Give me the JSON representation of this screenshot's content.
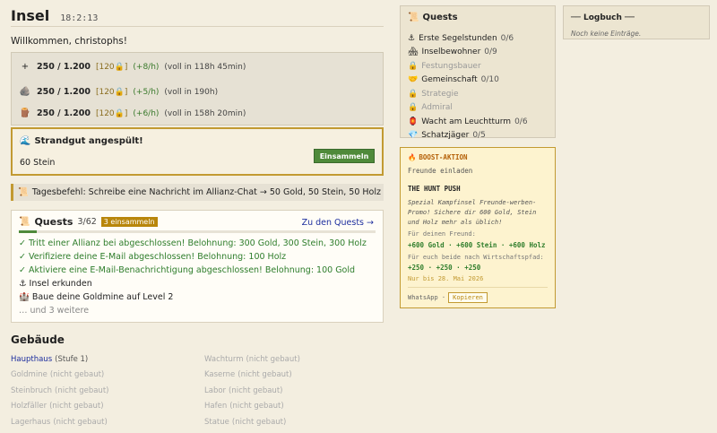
{
  "header": {
    "title": "Insel",
    "clock": "18:2:13"
  },
  "welcome": "Willkommen, christophs!",
  "resources": [
    {
      "icon": "gold-icon",
      "glyph": "+",
      "amount": "250 / 1.200",
      "cap": "[120🔒]",
      "rate": "(+8/h)",
      "full": "(voll in 118h 45min)"
    },
    {
      "icon": "stone-icon",
      "glyph": "🪨",
      "amount": "250 / 1.200",
      "cap": "[120🔒]",
      "rate": "(+5/h)",
      "full": "(voll in 190h)"
    },
    {
      "icon": "wood-icon",
      "glyph": "🪵",
      "amount": "250 / 1.200",
      "cap": "[120🔒]",
      "rate": "(+6/h)",
      "full": "(voll in 158h 20min)"
    }
  ],
  "alert": {
    "icon_glyph": "🌊",
    "title": "Strandgut angespült!",
    "text": "60 Stein",
    "button": "Einsammeln"
  },
  "daily": {
    "icon_glyph": "📜",
    "text": "Tagesbefehl: Schreibe eine Nachricht im Allianz-Chat → 50 Gold, 50 Stein, 50 Holz"
  },
  "quests": {
    "icon_glyph": "📜",
    "title": "Quests",
    "count": "3/62",
    "badge": "3 einsammeln",
    "link": "Zu den Quests →",
    "progress": 0.05,
    "items": [
      {
        "text": "✓ Tritt einer Allianz bei abgeschlossen! Belohnung: 300 Gold, 300 Stein, 300 Holz",
        "state": "done"
      },
      {
        "text": "✓ Verifiziere deine E-Mail abgeschlossen! Belohnung: 100 Holz",
        "state": "done"
      },
      {
        "text": "✓ Aktiviere eine E-Mail-Benachrichtigung abgeschlossen! Belohnung: 100 Gold",
        "state": "done"
      },
      {
        "text": "⚓ Insel erkunden",
        "state": "open"
      },
      {
        "text": "🏰 Baue deine Goldmine auf Level 2",
        "state": "open"
      },
      {
        "text": "… und 3 weitere",
        "state": "more"
      }
    ]
  },
  "buildings": {
    "title": "Gebäude",
    "col1": [
      {
        "name": "Haupthaus",
        "state": "(Stufe 1)",
        "active": true
      },
      {
        "name": "Goldmine",
        "state": "(nicht gebaut)",
        "active": false
      },
      {
        "name": "Steinbruch",
        "state": "(nicht gebaut)",
        "active": false
      },
      {
        "name": "Holzfäller",
        "state": "(nicht gebaut)",
        "active": false
      },
      {
        "name": "Lagerhaus",
        "state": "(nicht gebaut)",
        "active": false
      },
      {
        "name": "Steinmauer",
        "state": "(nicht gebaut)",
        "active": false
      }
    ],
    "col2": [
      {
        "name": "Wachturm",
        "state": "(nicht gebaut)",
        "active": false
      },
      {
        "name": "Kaserne",
        "state": "(nicht gebaut)",
        "active": false
      },
      {
        "name": "Labor",
        "state": "(nicht gebaut)",
        "active": false
      },
      {
        "name": "Hafen",
        "state": "(nicht gebaut)",
        "active": false
      },
      {
        "name": "Statue",
        "state": "(nicht gebaut)",
        "active": false
      },
      {
        "name": "Handelskontor",
        "state": "(nicht gebaut)",
        "active": false
      }
    ]
  },
  "side_quests": {
    "icon_glyph": "📜",
    "title": "Quests",
    "items": [
      {
        "glyph": "⚓",
        "name": "Erste Segelstunden",
        "progress": "0/6",
        "locked": false
      },
      {
        "glyph": "🏘",
        "name": "Inselbewohner",
        "progress": "0/9",
        "locked": false
      },
      {
        "glyph": "🔒",
        "name": "Festungsbauer",
        "progress": "",
        "locked": true
      },
      {
        "glyph": "🤝",
        "name": "Gemeinschaft",
        "progress": "0/10",
        "locked": false
      },
      {
        "glyph": "🔒",
        "name": "Strategie",
        "progress": "",
        "locked": true
      },
      {
        "glyph": "🔒",
        "name": "Admiral",
        "progress": "",
        "locked": true
      },
      {
        "glyph": "🏮",
        "name": "Wacht am Leuchtturm",
        "progress": "0/6",
        "locked": false
      },
      {
        "glyph": "💎",
        "name": "Schatzjäger",
        "progress": "0/5",
        "locked": false
      }
    ]
  },
  "boost": {
    "icon_glyph": "🔥",
    "header": "BOOST-AKTION",
    "sub": "Freunde einladen",
    "title": "THE HUNT PUSH",
    "desc": "Spezial Kampfinsel Freunde-werben-Promo! Sichere dir 600 Gold, Stein und Holz mehr als üblich!",
    "friend_label": "Für deinen Freund:",
    "friend_reward": "+600 Gold · +600 Stein · +600 Holz",
    "both_label": "Für euch beide nach Wirtschaftspfad:",
    "both_reward": "+250 · +250 · +250",
    "until": "Nur bis 28. Mai 2026",
    "share": "WhatsApp ·",
    "copy": "Kopieren"
  },
  "logbook": {
    "title": "── Logbuch ──",
    "empty": "Noch keine Einträge."
  }
}
